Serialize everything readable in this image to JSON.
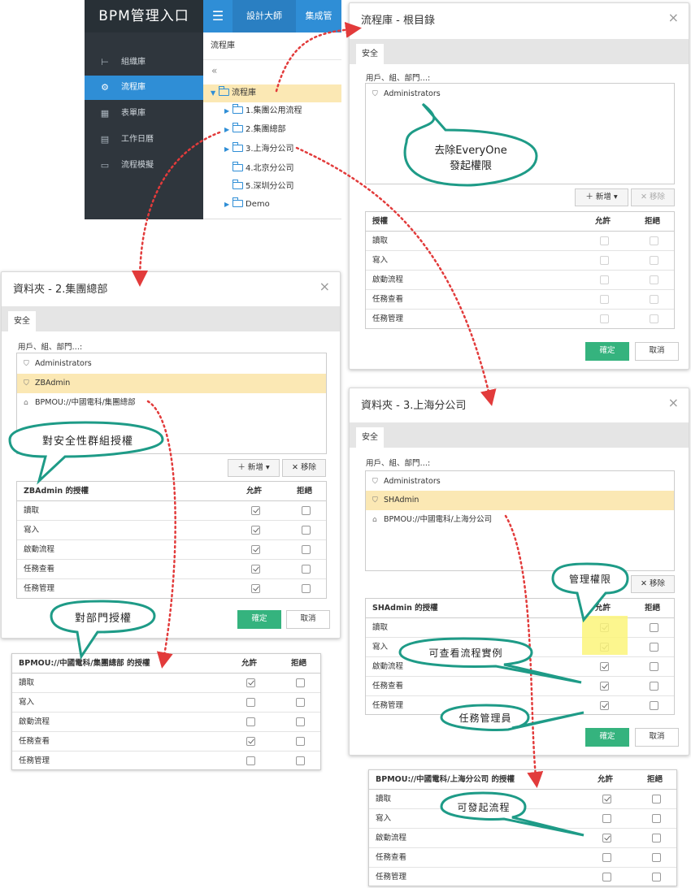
{
  "app": {
    "title": "BPM管理入口",
    "header_tabs": [
      "設計大師",
      "集成管"
    ]
  },
  "sidebar": {
    "items": [
      {
        "label": "組織庫",
        "icon": "org-icon"
      },
      {
        "label": "流程庫",
        "icon": "process-icon",
        "active": true
      },
      {
        "label": "表單庫",
        "icon": "form-icon"
      },
      {
        "label": "工作日曆",
        "icon": "calendar-icon"
      },
      {
        "label": "流程模擬",
        "icon": "simulate-icon"
      }
    ]
  },
  "tree": {
    "header": "流程庫",
    "collapse": "«",
    "root": "流程庫",
    "children": [
      "1.集團公用流程",
      "2.集團總部",
      "3.上海分公司",
      "4.北京分公司",
      "5.深圳分公司",
      "Demo"
    ]
  },
  "common": {
    "tab": "安全",
    "users_label": "用戶、組、部門…:",
    "add": "新增",
    "remove": "移除",
    "ok": "確定",
    "cancel": "取消",
    "allow": "允許",
    "deny": "拒絕",
    "perms": [
      "讀取",
      "寫入",
      "啟動流程",
      "任務查看",
      "任務管理"
    ]
  },
  "dlg_root": {
    "title": "流程庫 - 根目錄",
    "users": [
      "Administrators"
    ],
    "perm_header": "授權",
    "allow": [
      false,
      false,
      false,
      false,
      false
    ],
    "deny": [
      false,
      false,
      false,
      false,
      false
    ]
  },
  "dlg_hq": {
    "title": "資料夾 - 2.集團總部",
    "users": [
      "Administrators",
      "ZBAdmin",
      "BPMOU://中國電科/集團總部"
    ],
    "perm_header": "ZBAdmin 的授權",
    "allow": [
      true,
      true,
      true,
      true,
      true
    ],
    "deny": [
      false,
      false,
      false,
      false,
      false
    ]
  },
  "dlg_hq_dept": {
    "perm_header": "BPMOU://中國電科/集團總部 的授權",
    "allow": [
      true,
      false,
      false,
      true,
      false
    ],
    "deny": [
      false,
      false,
      false,
      false,
      false
    ]
  },
  "dlg_sh": {
    "title": "資料夾 - 3.上海分公司",
    "users": [
      "Administrators",
      "SHAdmin",
      "BPMOU://中國電科/上海分公司"
    ],
    "perm_header": "SHAdmin 的授權",
    "allow": [
      true,
      true,
      true,
      true,
      true
    ],
    "deny": [
      false,
      false,
      false,
      false,
      false
    ]
  },
  "dlg_sh_dept": {
    "perm_header": "BPMOU://中國電科/上海分公司 的授權",
    "allow": [
      true,
      false,
      true,
      false,
      false
    ],
    "deny": [
      false,
      false,
      false,
      false,
      false
    ]
  },
  "callouts": {
    "everyone": "去除EveryOne\n發起權限",
    "group": "對安全性群組授權",
    "dept": "對部門授權",
    "admin": "管理權限",
    "view": "可查看流程實例",
    "task": "任務管理員",
    "start": "可發起流程"
  },
  "colors": {
    "accent": "#2f8ed6",
    "sidebar": "#2f363d",
    "selected": "#fbe8b4",
    "ok": "#35b37e",
    "callout_border": "#1e9b87",
    "arrow": "#e23b3b"
  }
}
